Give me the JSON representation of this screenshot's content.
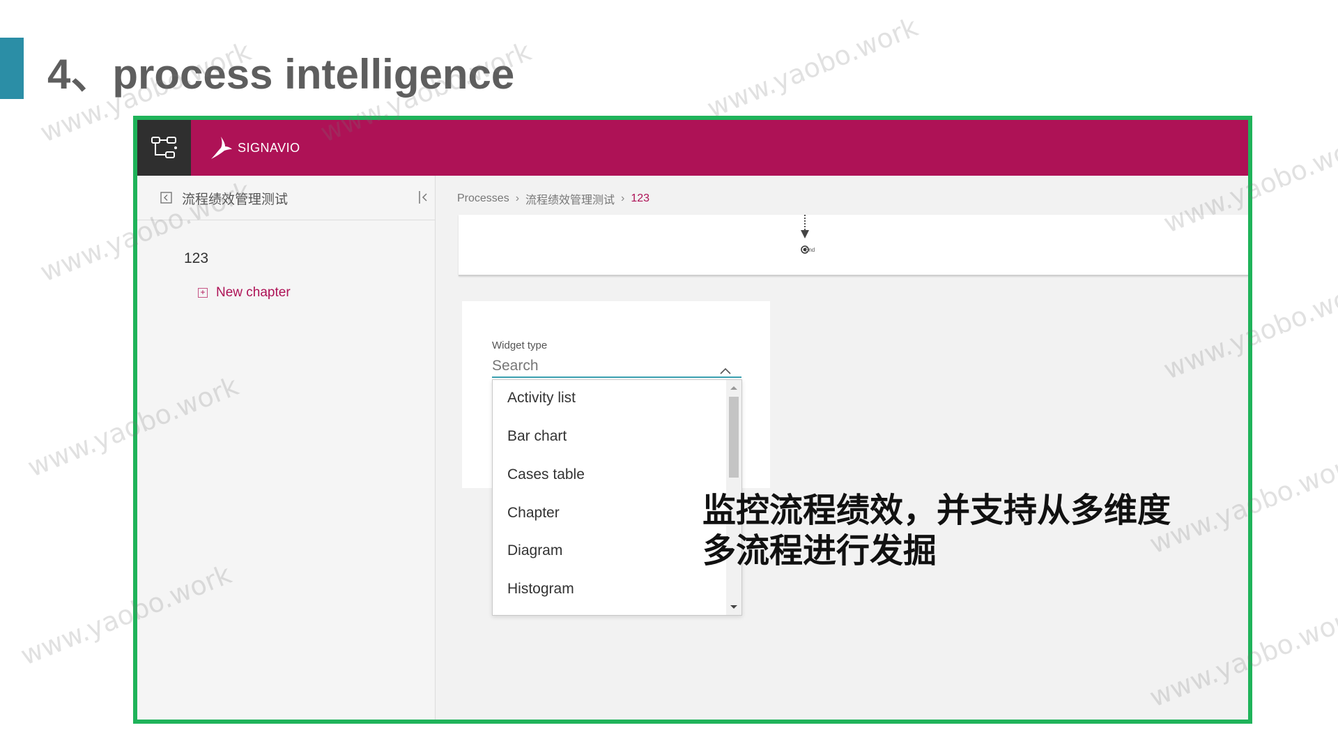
{
  "slide": {
    "title": "4、process intelligence",
    "accent_color": "#2b8ea6",
    "frame_color": "#1fb35a"
  },
  "watermark": {
    "text": "www.yaobo.work"
  },
  "app": {
    "brand": "SIGNAVIO",
    "brand_color": "#ae1256",
    "topbar_icon": "process-map-icon"
  },
  "sidebar": {
    "title": "流程绩效管理测试",
    "back_icon": "back-arrow-icon",
    "collapse_icon": "collapse-panel-icon",
    "items": [
      {
        "label": "123"
      }
    ],
    "new_chapter_label": "New chapter"
  },
  "breadcrumb": {
    "items": [
      "Processes",
      "流程绩效管理测试",
      "123"
    ]
  },
  "diagram": {
    "end_label": "End"
  },
  "widget": {
    "label": "Widget type",
    "placeholder": "Search",
    "options": [
      "Activity list",
      "Bar chart",
      "Cases table",
      "Chapter",
      "Diagram",
      "Histogram"
    ]
  },
  "overlay": {
    "line1": "监控流程绩效，并支持从多维度",
    "line2": "多流程进行发掘"
  }
}
